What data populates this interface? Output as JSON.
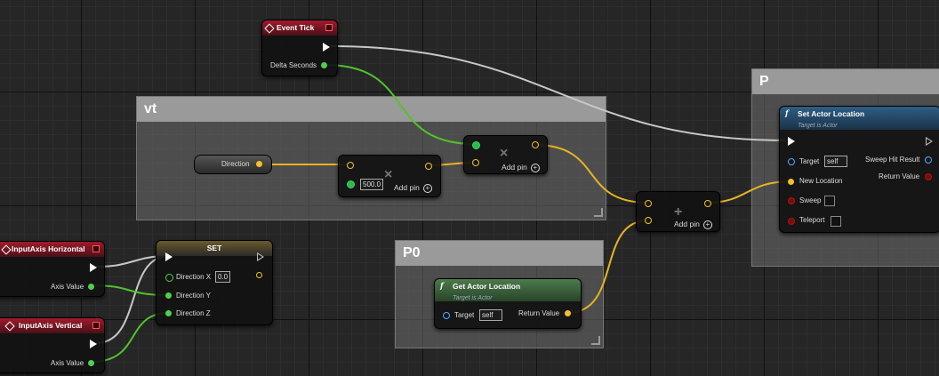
{
  "comments": {
    "vt": "vt",
    "p": "P",
    "p0": "P0"
  },
  "event_tick": {
    "title": "Event Tick",
    "delta": "Delta Seconds"
  },
  "multiply": {
    "value": "500.0",
    "add_pin": "Add pin",
    "op": "×"
  },
  "multiply2": {
    "add_pin": "Add pin",
    "op": "×"
  },
  "add_node": {
    "add_pin": "Add pin",
    "op": "+"
  },
  "direction_var": {
    "label": "Direction"
  },
  "set_actor": {
    "title": "Set Actor Location",
    "subtitle": "Target is Actor",
    "target": "Target",
    "target_value": "self",
    "new_location": "New Location",
    "sweep": "Sweep",
    "teleport": "Teleport",
    "sweep_hit": "Sweep Hit Result",
    "return": "Return Value",
    "fx": "f"
  },
  "get_actor": {
    "title": "Get Actor Location",
    "subtitle": "Target is Actor",
    "target": "Target",
    "target_value": "self",
    "return": "Return Value",
    "fx": "f"
  },
  "set_node": {
    "title": "SET",
    "dir_x": "Direction X",
    "dir_x_value": "0.0",
    "dir_y": "Direction Y",
    "dir_z": "Direction Z"
  },
  "input_h": {
    "title": "InputAxis Horizontal",
    "axis": "Axis Value"
  },
  "input_v": {
    "title": "InputAxis Vertical",
    "axis": "Axis Value"
  },
  "colors": {
    "exec_wire": "#c8c8c8",
    "float_wire": "#52c32c",
    "vector_wire": "#e8b323"
  }
}
